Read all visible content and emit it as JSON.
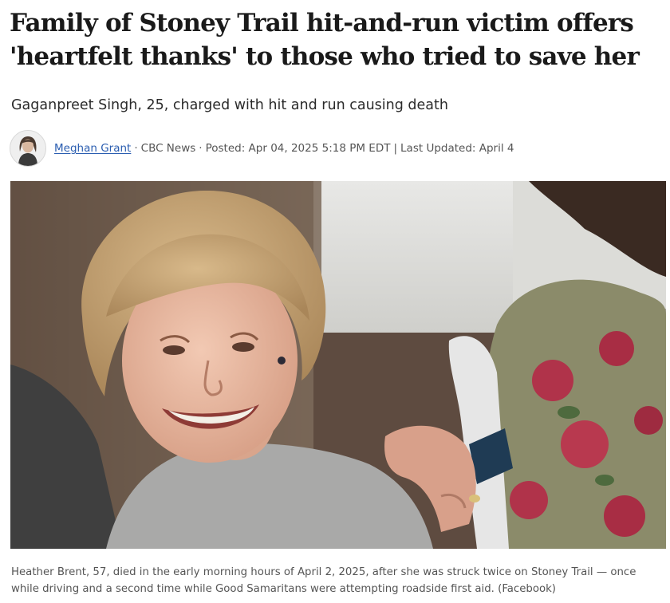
{
  "article": {
    "headline_line1": "Family of Stoney Trail hit-and-run victim offers",
    "headline_line2": "'heartfelt thanks' to those who tried to save her",
    "subheadline": "Gaganpreet Singh, 25, charged with hit and run causing death"
  },
  "byline": {
    "author": "Meghan Grant",
    "outlet": "CBC News",
    "posted": "Posted: Apr 04, 2025 5:18 PM EDT",
    "updated": "Last Updated: April 4",
    "separator_dot": "·",
    "separator_bar": "|"
  },
  "photo": {
    "caption": "Heather Brent, 57, died in the early morning hours of April 2, 2025, after she was struck twice on Stoney Trail — once while driving and a second time while Good Samaritans were attempting roadside first aid. (Facebook)"
  },
  "colors": {
    "link": "#2a5db0",
    "meta_text": "#555555",
    "headline": "#1a1a1a"
  },
  "icons": {
    "avatar": "author-avatar"
  }
}
